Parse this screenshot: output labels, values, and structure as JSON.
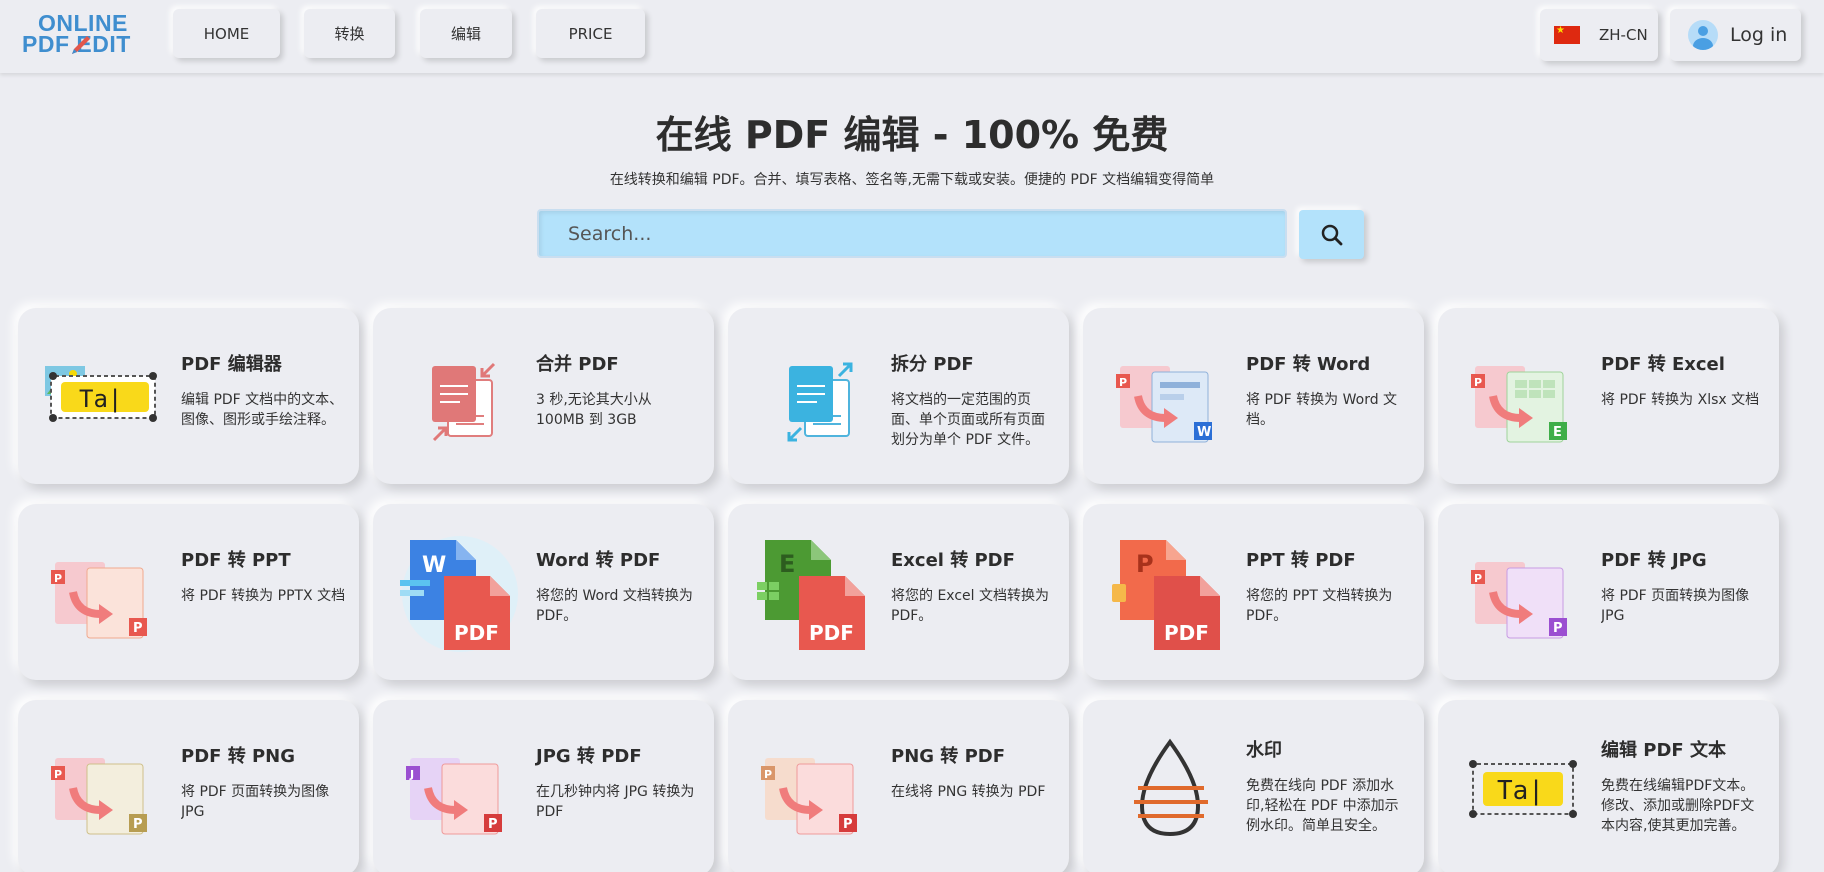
{
  "header": {
    "logo": {
      "line1": "ONLINE",
      "line2": "PDF EDIT"
    },
    "nav": [
      "HOME",
      "转换",
      "编辑",
      "PRICE"
    ],
    "lang": "ZH-CN",
    "login": "Log in"
  },
  "hero": {
    "title": "在线 PDF 编辑 - 100% 免费",
    "subtitle": "在线转换和编辑 PDF。合并、填写表格、签名等,无需下载或安装。便捷的 PDF 文档编辑变得简单",
    "search_placeholder": "Search..."
  },
  "tools": [
    {
      "title": "PDF 编辑器",
      "desc": "编辑 PDF 文档中的文本、图像、图形或手绘注释。",
      "icon": "pdf-editor-icon"
    },
    {
      "title": "合并 PDF",
      "desc": "3 秒,无论其大小从 100MB 到 3GB",
      "icon": "merge-pdf-icon"
    },
    {
      "title": "拆分 PDF",
      "desc": "将文档的一定范围的页面、单个页面或所有页面划分为单个 PDF 文件。",
      "icon": "split-pdf-icon"
    },
    {
      "title": "PDF 转 Word",
      "desc": "将 PDF 转换为 Word 文档。",
      "icon": "pdf-to-word-icon"
    },
    {
      "title": "PDF 转 Excel",
      "desc": "将 PDF 转换为 Xlsx 文档",
      "icon": "pdf-to-excel-icon"
    },
    {
      "title": "PDF 转 PPT",
      "desc": "将 PDF 转换为 PPTX 文档",
      "icon": "pdf-to-ppt-icon"
    },
    {
      "title": "Word 转 PDF",
      "desc": "将您的 Word 文档转换为 PDF。",
      "icon": "word-to-pdf-icon"
    },
    {
      "title": "Excel 转 PDF",
      "desc": "将您的 Excel 文档转换为 PDF。",
      "icon": "excel-to-pdf-icon"
    },
    {
      "title": "PPT 转 PDF",
      "desc": "将您的 PPT 文档转换为 PDF。",
      "icon": "ppt-to-pdf-icon"
    },
    {
      "title": "PDF 转 JPG",
      "desc": "将 PDF 页面转换为图像 JPG",
      "icon": "pdf-to-jpg-icon"
    },
    {
      "title": "PDF 转 PNG",
      "desc": "将 PDF 页面转换为图像 JPG",
      "icon": "pdf-to-png-icon"
    },
    {
      "title": "JPG 转 PDF",
      "desc": "在几秒钟内将 JPG 转换为 PDF",
      "icon": "jpg-to-pdf-icon"
    },
    {
      "title": "PNG 转 PDF",
      "desc": "在线将 PNG 转换为 PDF",
      "icon": "png-to-pdf-icon"
    },
    {
      "title": "水印",
      "desc": "免费在线向 PDF 添加水印,轻松在 PDF 中添加示例水印。简单且安全。",
      "icon": "watermark-icon"
    },
    {
      "title": "编辑 PDF 文本",
      "desc": "免费在线编辑PDF文本。修改、添加或删除PDF文本内容,使其更加完善。",
      "icon": "edit-pdf-text-icon"
    }
  ],
  "colors": {
    "accent": "#b3e2fb",
    "logo": "#3f8ecf",
    "pdf_red": "#e8584f"
  }
}
